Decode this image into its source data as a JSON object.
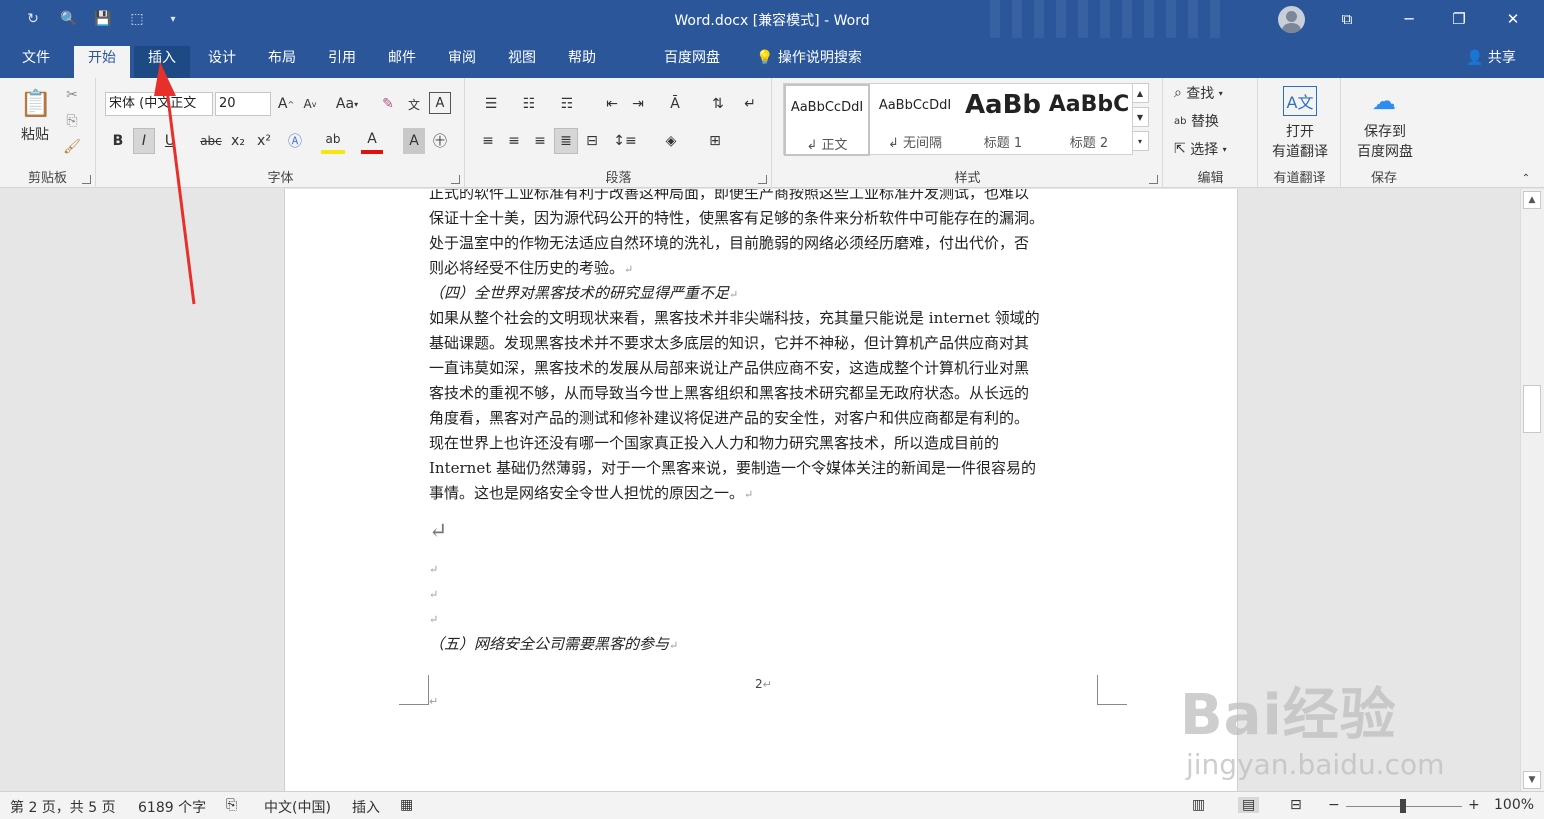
{
  "window": {
    "title": "Word.docx [兼容模式] - Word",
    "share_label": "共享"
  },
  "menu": {
    "tabs": [
      "文件",
      "开始",
      "插入",
      "设计",
      "布局",
      "引用",
      "邮件",
      "审阅",
      "视图",
      "帮助",
      "百度网盘",
      "操作说明搜索"
    ],
    "active_tab": "开始",
    "highlighted_tab": "插入"
  },
  "ribbon": {
    "clipboard": {
      "paste": "粘贴",
      "label": "剪贴板"
    },
    "font": {
      "font_name": "宋体 (中文正文",
      "font_size": "20",
      "label": "字体",
      "case_button": "Aa",
      "bold": "B",
      "italic": "I",
      "underline": "U",
      "strike": "abc",
      "sub": "x₂",
      "sup": "x²"
    },
    "paragraph": {
      "label": "段落"
    },
    "styles": {
      "label": "样式",
      "items": [
        {
          "sample": "AaBbCcDdI",
          "name": "↲ 正文"
        },
        {
          "sample": "AaBbCcDdI",
          "name": "↲ 无间隔"
        },
        {
          "sample": "AaBb",
          "name": "标题 1"
        },
        {
          "sample": "AaBbC",
          "name": "标题 2"
        }
      ]
    },
    "editing": {
      "find": "查找",
      "replace": "替换",
      "select": "选择",
      "label": "编辑"
    },
    "youdao": {
      "open": "打开",
      "translate": "有道翻译",
      "label": "有道翻译"
    },
    "save": {
      "save_to": "保存到",
      "baidu": "百度网盘",
      "label": "保存"
    }
  },
  "document": {
    "lines": [
      "正式的软件工业标准有利于改善这种局面，即便生产商按照这些工业标准开发测试，也难以",
      "保证十全十美，因为源代码公开的特性，使黑客有足够的条件来分析软件中可能存在的漏洞。",
      "处于温室中的作物无法适应自然环境的洗礼，目前脆弱的网络必须经历磨难，付出代价，否",
      "则必将经受不住历史的考验。",
      "（四）全世界对黑客技术的研究显得严重不足",
      "如果从整个社会的文明现状来看，黑客技术并非尖端科技，充其量只能说是 internet 领域的",
      "基础课题。发现黑客技术并不要求太多底层的知识，它并不神秘，但计算机产品供应商对其",
      "一直讳莫如深，黑客技术的发展从局部来说让产品供应商不安，这造成整个计算机行业对黑",
      "客技术的重视不够，从而导致当今世上黑客组织和黑客技术研究都呈无政府状态。从长远的",
      "角度看，黑客对产品的测试和修补建议将促进产品的安全性，对客户和供应商都是有利的。",
      "现在世界上也许还没有哪一个国家真正投入人力和物力研究黑客技术，所以造成目前的",
      "Internet 基础仍然薄弱，对于一个黑客来说，要制造一个令媒体关注的新闻是一件很容易的",
      "事情。这也是网络安全令世人担忧的原因之一。"
    ],
    "heading_five": "（五）网络安全公司需要黑客的参与",
    "page_number": "2",
    "paragraph_mark": "↵"
  },
  "status": {
    "page": "第 2 页，共 5 页",
    "words": "6189 个字",
    "language": "中文(中国)",
    "mode": "插入",
    "zoom": "100%",
    "zoom_minus": "−",
    "zoom_plus": "+"
  },
  "watermark": {
    "brand": "Bai经验",
    "site": "jingyan.baidu.com"
  },
  "colors": {
    "accent": "#2b579a",
    "ribbon_bg": "#f3f3f3",
    "arrow": "#e8302a"
  }
}
